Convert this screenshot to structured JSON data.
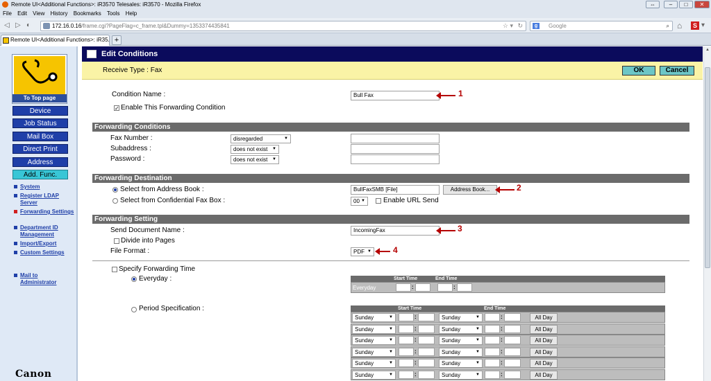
{
  "window": {
    "title": "Remote UI<Additional Functions>: iR3570 Telesales: iR3570 - Mozilla Firefox",
    "menu": [
      "File",
      "Edit",
      "View",
      "History",
      "Bookmarks",
      "Tools",
      "Help"
    ]
  },
  "browser": {
    "url_host": "172.16.0.16",
    "url_path": "/frame.cgi?PageFlag=c_frame.tpl&Dummy=1353374435841",
    "search_placeholder": "Google",
    "tab_title": "Remote UI<Additional Functions>: iR35..."
  },
  "sidebar": {
    "top_page": "To Top page",
    "buttons": [
      "Device",
      "Job Status",
      "Mail Box",
      "Direct Print",
      "Address",
      "Add. Func."
    ],
    "menu": [
      "System",
      "Register LDAP Server",
      "Forwarding Settings",
      "Department ID Management",
      "Import/Export",
      "Custom Settings"
    ],
    "mail_admin": "Mail to Administrator",
    "brand": "Canon"
  },
  "header": {
    "title": "Edit Conditions",
    "receive_type": "Receive Type : Fax",
    "ok": "OK",
    "cancel": "Cancel"
  },
  "form": {
    "condition_name_label": "Condition Name :",
    "condition_name_value": "Bull Fax",
    "enable_label": "Enable This Forwarding Condition",
    "enable_checked": true,
    "section_conditions": "Forwarding Conditions",
    "fax_number_label": "Fax Number :",
    "fax_number_select": "disregarded",
    "subaddress_label": "Subaddress :",
    "subaddress_select": "does not exist",
    "password_label": "Password :",
    "password_select": "does not exist",
    "section_destination": "Forwarding Destination",
    "select_address_book_label": "Select from Address Book :",
    "address_book_value": "BullFaxSMB [File]",
    "address_book_button": "Address Book...",
    "confidential_label": "Select from Confidential Fax Box :",
    "confidential_value": "00",
    "enable_url_send": "Enable URL Send",
    "section_setting": "Forwarding Setting",
    "send_doc_label": "Send Document Name :",
    "send_doc_value": "IncomingFax",
    "divide_label": "Divide into Pages",
    "file_format_label": "File Format :",
    "file_format_value": "PDF",
    "specify_time_label": "Specify Forwarding Time",
    "everyday_label": "Everyday :",
    "period_label": "Period Specification :",
    "start_time": "Start Time",
    "end_time": "End Time",
    "everyday_row": "Everyday",
    "period_rows": [
      {
        "start_day": "Sunday",
        "end_day": "Sunday",
        "button": "All Day"
      },
      {
        "start_day": "Sunday",
        "end_day": "Sunday",
        "button": "All Day"
      },
      {
        "start_day": "Sunday",
        "end_day": "Sunday",
        "button": "All Day"
      },
      {
        "start_day": "Sunday",
        "end_day": "Sunday",
        "button": "All Day"
      },
      {
        "start_day": "Sunday",
        "end_day": "Sunday",
        "button": "All Day"
      },
      {
        "start_day": "Sunday",
        "end_day": "Sunday",
        "button": "All Day"
      }
    ]
  },
  "annotations": [
    "1",
    "2",
    "3",
    "4"
  ],
  "colors": {
    "header_bg": "#0b0b5c",
    "yellow_bar": "#faf3a6",
    "section_band": "#6b6b6b",
    "annotation_red": "#b50000",
    "nav_button": "#1f3fa8",
    "nav_active": "#38c6d6"
  }
}
